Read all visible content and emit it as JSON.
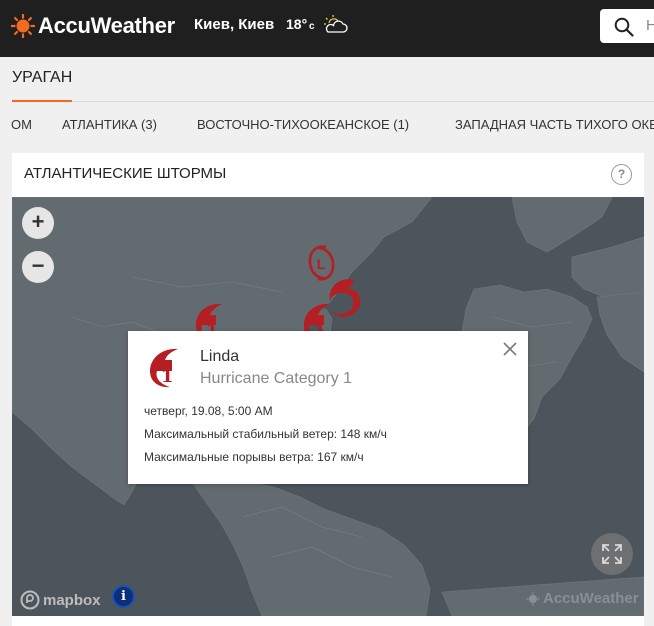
{
  "header": {
    "brand": "AccuWeather",
    "location": "Киев, Киев",
    "temperature": "18°",
    "temperature_unit": "c",
    "search_placeholder": "Н",
    "colors": {
      "background": "#1f1f1f",
      "brand_orange": "#f26b21"
    }
  },
  "page": {
    "title": "УРАГАН"
  },
  "tabs": [
    {
      "label": "ОМ"
    },
    {
      "label": "АТЛАНТИКА (3)",
      "active": true
    },
    {
      "label": "ВОСТОЧНО-ТИХООКЕАНСКОЕ (1)"
    },
    {
      "label": "ЗАПАДНАЯ ЧАСТЬ ТИХОГО ОКЕАНА"
    }
  ],
  "card": {
    "title": "АТЛАНТИЧЕСКИЕ ШТОРМЫ",
    "help": "?"
  },
  "map": {
    "zoom_in": "+",
    "zoom_out": "−",
    "attribution_left": "mapbox",
    "attribution_right": "AccuWeather",
    "info": "i",
    "storm_markers": [
      {
        "icon": "hurricane-icon",
        "label": "1"
      },
      {
        "icon": "hurricane-icon",
        "label": "1"
      },
      {
        "icon": "hurricane-icon",
        "label": ""
      },
      {
        "icon": "low-pressure-icon",
        "label": "L"
      }
    ]
  },
  "popup": {
    "name": "Linda",
    "category": "Hurricane Category 1",
    "icon_label": "1",
    "datetime": "четверг, 19.08, 5:00 AM",
    "max_sustained_wind": "Максимальный стабильный ветер: 148 км/ч",
    "max_gusts": "Максимальные порывы ветра: 167 км/ч"
  }
}
